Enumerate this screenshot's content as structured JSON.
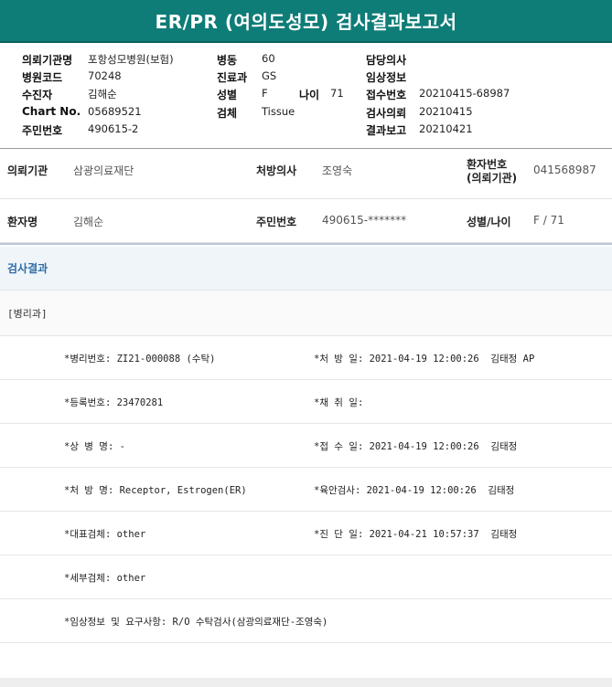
{
  "report": {
    "title": "ER/PR (여의도성모) 검사결과보고서",
    "fields": {
      "institution_label": "의뢰기관명",
      "institution_value": "포항성모병원(보험)",
      "hospcode_label": "병원코드",
      "hospcode_value": "70248",
      "examinee_label": "수진자",
      "examinee_value": "김해순",
      "chart_label": "Chart No.",
      "chart_value": "05689521",
      "rrn_label": "주민번호",
      "rrn_value": "490615-2",
      "ward_label": "병동",
      "ward_value": "60",
      "dept_label": "진료과",
      "dept_value": "GS",
      "sex_label": "성별",
      "sex_value": "F",
      "age_label": "나이",
      "age_value": "71",
      "specimen_label": "검체",
      "specimen_value": "Tissue",
      "doctor_label": "담당의사",
      "doctor_value": "",
      "clinical_label": "임상정보",
      "clinical_value": "",
      "receipt_label": "접수번호",
      "receipt_value": "20210415-68987",
      "request_label": "검사의뢰",
      "request_value": "20210415",
      "resultrep_label": "결과보고",
      "resultrep_value": "20210421"
    }
  },
  "patient": {
    "institution_label": "의뢰기관",
    "institution_value": "삼광의료재단",
    "prescriber_label": "처방의사",
    "prescriber_value": "조영숙",
    "patno_label_1": "환자번호",
    "patno_label_2": "(의뢰기관)",
    "patno_value": "041568987",
    "name_label": "환자명",
    "name_value": "김해순",
    "rrn_label": "주민번호",
    "rrn_value": "490615-*******",
    "sexage_label": "성별/나이",
    "sexage_value": "F / 71"
  },
  "results": {
    "section_title": "검사결과",
    "department": "[병리과]",
    "rows": [
      {
        "left": "*병리번호: ZI21-000088 (수탁)",
        "right": "*처 방 일: 2021-04-19 12:00:26  김태정 AP"
      },
      {
        "left": "*등록번호: 23470281",
        "right": "*채 취 일:"
      },
      {
        "left": "*상 병 명: -",
        "right": "*접 수 일: 2021-04-19 12:00:26  김태정"
      },
      {
        "left": "*처 방 명: Receptor, Estrogen(ER)",
        "right": "*육안검사: 2021-04-19 12:00:26  김태정"
      },
      {
        "left": "*대표검체: other",
        "right": "*진 단 일: 2021-04-21 10:57:37  김태정"
      },
      {
        "left": "*세부검체: other",
        "right": ""
      },
      {
        "left": "*임상정보 및 요구사항: R/O 수탁검사(삼광의료재단-조영숙)",
        "right": ""
      }
    ]
  }
}
